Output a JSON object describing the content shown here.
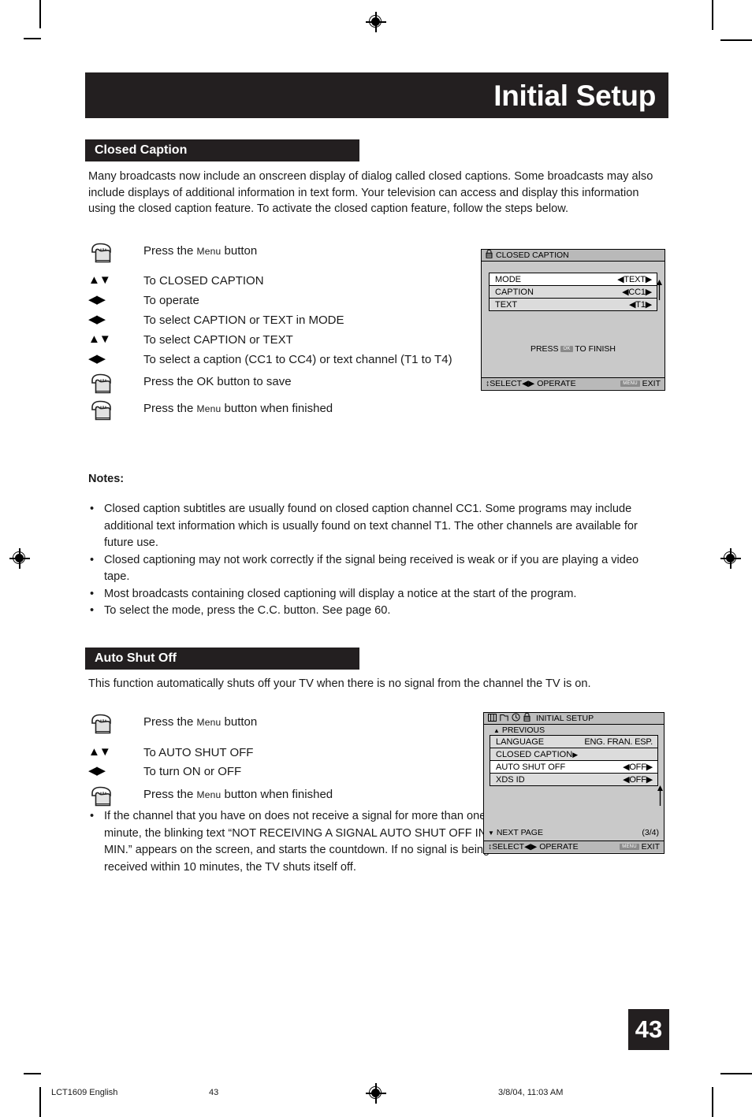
{
  "page": {
    "title": "Initial Setup",
    "number": "43"
  },
  "closed_caption": {
    "heading": "Closed Caption",
    "intro": "Many broadcasts now include an onscreen display of dialog called closed captions. Some broadcasts may also include displays of additional information in text form. Your television can access and display this information using the closed caption feature. To activate the closed caption feature, follow the steps below.",
    "steps": [
      {
        "icon": "hand-press-icon",
        "text_pre": "Press the ",
        "text_sc": "Menu",
        "text_post": " button"
      },
      {
        "icon": "up-down-arrows-icon",
        "glyph": "▲▼",
        "text": "To CLOSED CAPTION"
      },
      {
        "icon": "left-right-arrows-icon",
        "glyph": "◀▶",
        "text": "To operate"
      },
      {
        "icon": "left-right-arrows-icon",
        "glyph": "◀▶",
        "text": "To select CAPTION or TEXT in MODE"
      },
      {
        "icon": "up-down-arrows-icon",
        "glyph": "▲▼",
        "text": "To select CAPTION or TEXT"
      },
      {
        "icon": "left-right-arrows-icon",
        "glyph": "◀▶",
        "text": "To select a caption (CC1 to CC4) or text channel (T1 to T4)"
      },
      {
        "icon": "hand-press-icon",
        "text_pre": "Press the OK button to save",
        "text_sc": "",
        "text_post": ""
      },
      {
        "icon": "hand-press-icon",
        "text_pre": "Press the ",
        "text_sc": "Menu",
        "text_post": " button when finished"
      }
    ],
    "notes_label": "Notes:",
    "notes": [
      "Closed caption subtitles are usually found on closed caption channel CC1. Some programs may include additional text information which is usually found on text channel T1. The other channels are available for future use.",
      "Closed captioning may not work correctly if the signal being received is weak or if you are playing a video tape.",
      "Most broadcasts containing closed captioning will display a notice at the start of the program.",
      "To select the mode, press the C.C. button. See page 60."
    ],
    "bullet": "•"
  },
  "osd_closed_caption": {
    "title": "CLOSED CAPTION",
    "title_icon": "padlock-icon",
    "rows": [
      {
        "label": "MODE",
        "value": "TEXT",
        "left_arrow": "◀",
        "right_arrow": "▶",
        "highlight": true
      },
      {
        "label": "CAPTION",
        "value": "CC1",
        "left_arrow": "◀",
        "right_arrow": "▶",
        "highlight": false
      },
      {
        "label": "TEXT",
        "value": "T1",
        "left_arrow": "◀",
        "right_arrow": "▶",
        "highlight": false
      }
    ],
    "finish_pre": "PRESS ",
    "finish_key": "OK",
    "finish_post": " TO FINISH",
    "footer_select": "SELECT",
    "footer_select_glyph": "↕",
    "footer_operate": "OPERATE",
    "footer_operate_glyph": "◀▶",
    "footer_exit_key": "MENU",
    "footer_exit": "EXIT"
  },
  "auto_shut_off": {
    "heading": "Auto Shut Off",
    "intro": "This function automatically shuts off your TV when there is no signal from the channel the TV is on.",
    "steps": [
      {
        "icon": "hand-press-icon",
        "text_pre": "Press the ",
        "text_sc": "Menu",
        "text_post": " button"
      },
      {
        "icon": "up-down-arrows-icon",
        "glyph": "▲▼",
        "text": "To AUTO SHUT OFF"
      },
      {
        "icon": "left-right-arrows-icon",
        "glyph": "◀▶",
        "text": "To turn ON or OFF"
      },
      {
        "icon": "hand-press-icon",
        "text_pre": "Press the ",
        "text_sc": "Menu",
        "text_post": " button when finished"
      }
    ],
    "note": "If the channel that you have on does not receive a signal for more than one minute, the blinking text “NOT RECEIVING A SIGNAL AUTO SHUT OFF IN 9 MIN.” appears on the screen, and starts the countdown. If no signal is being received within 10 minutes, the TV shuts itself off.",
    "bullet": "•"
  },
  "osd_initial_setup": {
    "title": "INITIAL SETUP",
    "icons": [
      "picture-icon",
      "folder-icon",
      "clock-icon",
      "padlock-icon"
    ],
    "previous": "PREVIOUS",
    "previous_glyph": "▲",
    "rows": [
      {
        "label": "LANGUAGE",
        "value": "ENG. FRAN. ESP.",
        "type": "language",
        "highlight": false
      },
      {
        "label": "CLOSED CAPTION",
        "value": "▶",
        "type": "submenu",
        "highlight": false
      },
      {
        "label": "AUTO SHUT OFF",
        "value": "OFF",
        "type": "toggle",
        "left_arrow": "◀",
        "right_arrow": "▶",
        "highlight": true
      },
      {
        "label": "XDS ID",
        "value": "OFF",
        "type": "toggle",
        "left_arrow": "◀",
        "right_arrow": "▶",
        "highlight": false
      }
    ],
    "next_page": "NEXT PAGE",
    "next_page_glyph": "▼",
    "page_indicator": "(3/4)",
    "footer_select": "SELECT",
    "footer_select_glyph": "↕",
    "footer_operate": "OPERATE",
    "footer_operate_glyph": "◀▶",
    "footer_exit_key": "MENU",
    "footer_exit": "EXIT"
  },
  "footer": {
    "doc_id": "LCT1609 English",
    "page_num": "43",
    "timestamp": "3/8/04, 11:03 AM"
  }
}
